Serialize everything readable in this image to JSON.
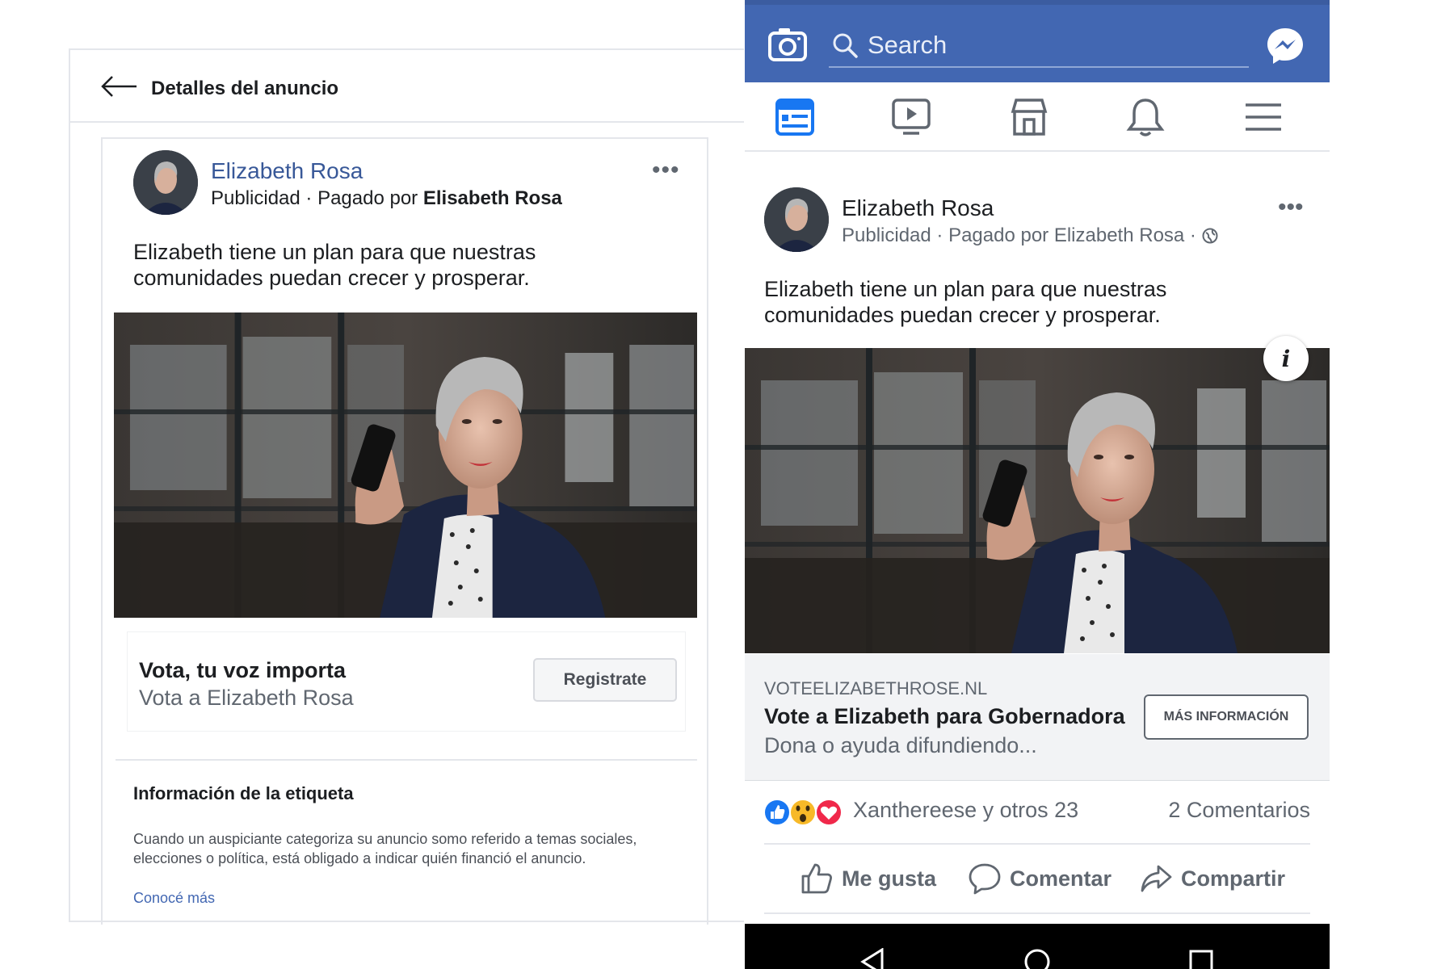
{
  "left_panel": {
    "header_title": "Detalles del anuncio",
    "post": {
      "author": "Elizabeth Rosa",
      "meta_prefix": "Publicidad · Pagado por ",
      "meta_payer": "Elisabeth Rosa",
      "text": "Elizabeth tiene un plan para que nuestras comunidades puedan crecer y prosperar.",
      "cta_title": "Vota, tu voz importa",
      "cta_subtitle": "Vota a Elizabeth Rosa",
      "cta_button": "Registrate"
    },
    "label_info": {
      "title": "Información de la etiqueta",
      "body": "Cuando un auspiciante categoriza su anuncio somo referido a temas sociales, elecciones o política, está obligado a indicar quién financió el anuncio.",
      "link": "Conocé más"
    }
  },
  "right_panel": {
    "search_placeholder": "Search",
    "post": {
      "author": "Elizabeth Rosa",
      "meta": "Publicidad · Pagado por Elizabeth Rosa ·",
      "text": "Elizabeth tiene un plan para que nuestras comunidades puedan crecer y prosperar.",
      "info_badge": "i",
      "link_domain": "VOTEELIZABETHROSE.NL",
      "link_title": "Vote a Elizabeth para Gobernadora",
      "link_description": "Dona o ayuda difundiendo...",
      "link_button": "MÁS INFORMACIÓN",
      "reaction_names": "Xanthereese y otros 23",
      "comment_count": "2 Comentarios",
      "actions": {
        "like": "Me gusta",
        "comment": "Comentar",
        "share": "Compartir"
      }
    }
  },
  "colors": {
    "facebook_blue": "#4267b2",
    "link_blue": "#385898",
    "like_blue": "#1877f2",
    "love_red": "#f0284a",
    "wow_yellow": "#f7b928"
  }
}
